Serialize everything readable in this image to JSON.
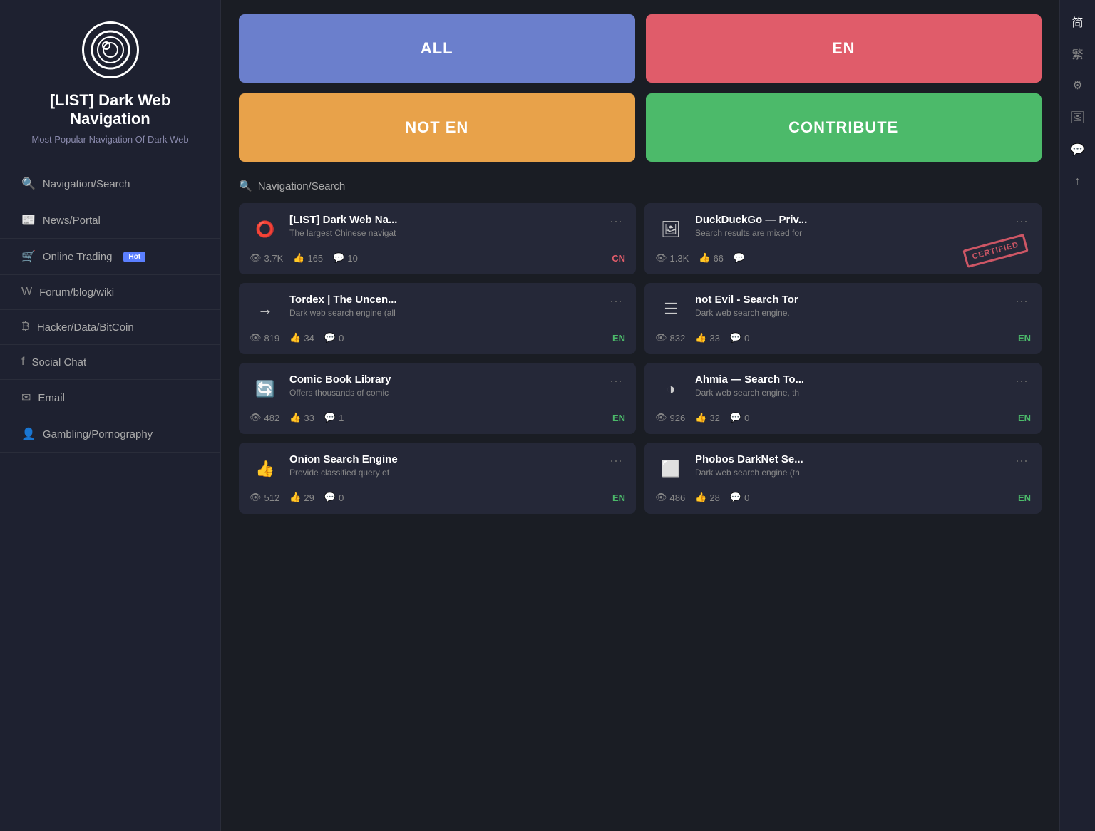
{
  "sidebar": {
    "app_title": "[LIST] Dark Web Navigation",
    "app_subtitle": "Most Popular Navigation Of Dark Web",
    "nav_items": [
      {
        "id": "navigation-search",
        "icon": "🔍",
        "label": "Navigation/Search"
      },
      {
        "id": "news-portal",
        "icon": "📰",
        "label": "News/Portal"
      },
      {
        "id": "online-trading",
        "icon": "🛒",
        "label": "Online Trading",
        "badge": "Hot"
      },
      {
        "id": "forum-blog-wiki",
        "icon": "W",
        "label": "Forum/blog/wiki"
      },
      {
        "id": "hacker-data-bitcoin",
        "icon": "₿",
        "label": "Hacker/Data/BitCoin"
      },
      {
        "id": "social-chat",
        "icon": "f",
        "label": "Social Chat"
      },
      {
        "id": "email",
        "icon": "✉",
        "label": "Email"
      },
      {
        "id": "gambling-pornography",
        "icon": "👤",
        "label": "Gambling/Pornography"
      }
    ]
  },
  "filter_buttons": [
    {
      "id": "all",
      "label": "ALL",
      "class": "btn-all"
    },
    {
      "id": "en",
      "label": "EN",
      "class": "btn-en"
    },
    {
      "id": "not-en",
      "label": "NOT EN",
      "class": "btn-not-en"
    },
    {
      "id": "contribute",
      "label": "CONTRIBUTE",
      "class": "btn-contribute"
    }
  ],
  "section_label": "Navigation/Search",
  "cards": [
    {
      "id": "card-1",
      "title": "[LIST] Dark Web Na...",
      "desc": "The largest Chinese navigat",
      "icon": "⭕",
      "views": "3.7K",
      "likes": "165",
      "comments": "10",
      "lang": "CN",
      "lang_class": "lang-cn",
      "certified": false
    },
    {
      "id": "card-2",
      "title": "DuckDuckGo — Priv...",
      "desc": "Search results are mixed for",
      "icon": "🖼",
      "views": "1.3K",
      "likes": "66",
      "comments": "",
      "lang": "",
      "lang_class": "",
      "certified": true
    },
    {
      "id": "card-3",
      "title": "Tordex | The Uncen...",
      "desc": "Dark web search engine (all",
      "icon": "→",
      "views": "819",
      "likes": "34",
      "comments": "0",
      "lang": "EN",
      "lang_class": "lang-en",
      "certified": false
    },
    {
      "id": "card-4",
      "title": "not Evil - Search Tor",
      "desc": "Dark web search engine.",
      "icon": "☰",
      "views": "832",
      "likes": "33",
      "comments": "0",
      "lang": "EN",
      "lang_class": "lang-en",
      "certified": false
    },
    {
      "id": "card-5",
      "title": "Comic Book Library",
      "desc": "Offers thousands of comic",
      "icon": "🔄",
      "views": "482",
      "likes": "33",
      "comments": "1",
      "lang": "EN",
      "lang_class": "lang-en",
      "certified": false
    },
    {
      "id": "card-6",
      "title": "Ahmia — Search To...",
      "desc": "Dark web search engine, th",
      "icon": "◑",
      "views": "926",
      "likes": "32",
      "comments": "0",
      "lang": "EN",
      "lang_class": "lang-en",
      "certified": false
    },
    {
      "id": "card-7",
      "title": "Onion Search Engine",
      "desc": "Provide classified query of",
      "icon": "👍",
      "views": "512",
      "likes": "29",
      "comments": "0",
      "lang": "EN",
      "lang_class": "lang-en",
      "certified": false
    },
    {
      "id": "card-8",
      "title": "Phobos DarkNet Se...",
      "desc": "Dark web search engine (th",
      "icon": "⬜",
      "views": "486",
      "likes": "28",
      "comments": "0",
      "lang": "EN",
      "lang_class": "lang-en",
      "certified": false
    }
  ],
  "right_icons": [
    {
      "id": "simplified-chinese",
      "symbol": "简",
      "active": true
    },
    {
      "id": "traditional-chinese",
      "symbol": "繁",
      "active": false
    },
    {
      "id": "settings-icon",
      "symbol": "⚙",
      "active": false
    },
    {
      "id": "image-icon",
      "symbol": "🖼",
      "active": false
    },
    {
      "id": "chat-icon",
      "symbol": "💬",
      "active": false
    },
    {
      "id": "up-icon",
      "symbol": "↑",
      "active": false
    }
  ]
}
